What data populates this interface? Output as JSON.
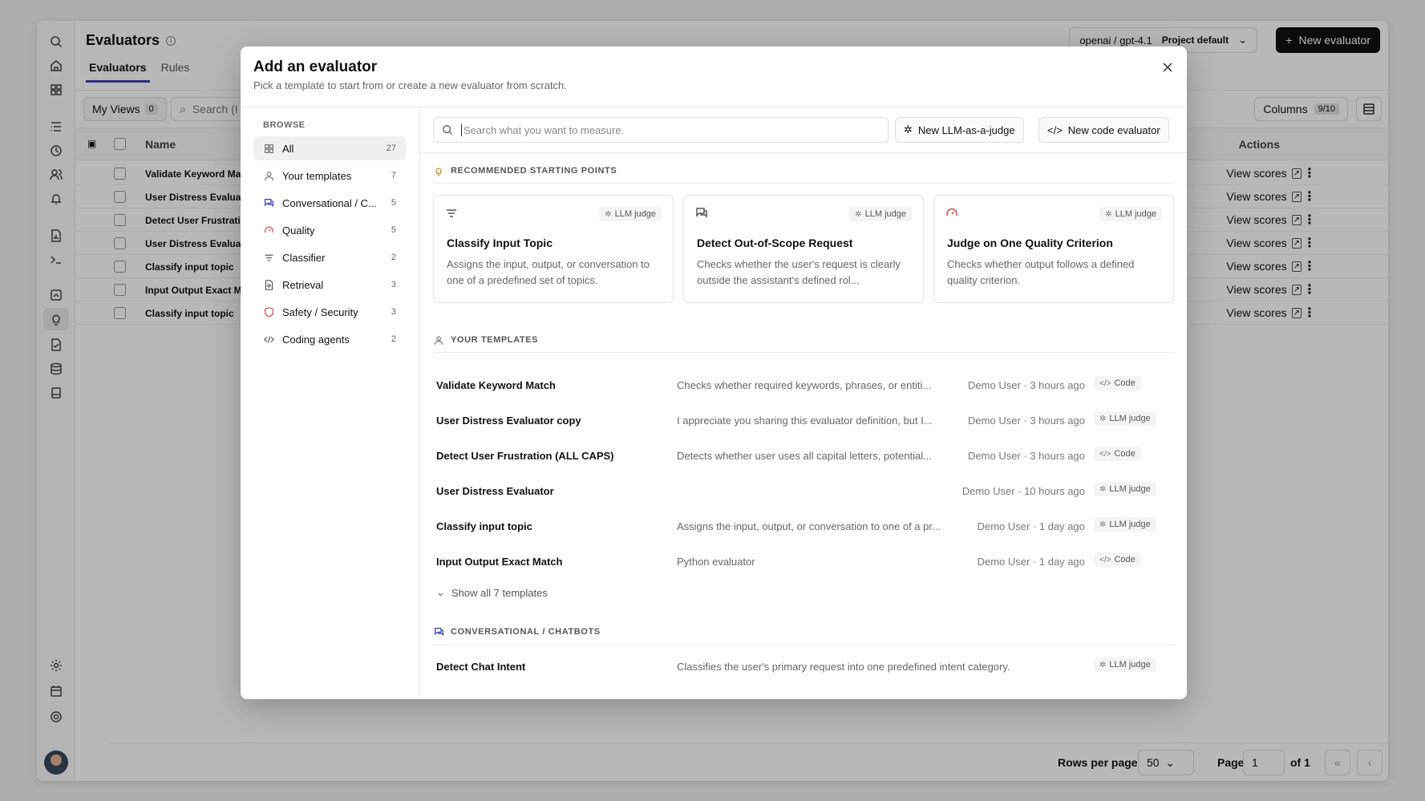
{
  "page": {
    "title": "Evaluators",
    "tabs": [
      {
        "label": "Evaluators"
      },
      {
        "label": "Rules"
      }
    ],
    "model_label": "openai / gpt-4.1",
    "model_badge": "Project default",
    "new_evaluator_label": "New evaluator",
    "my_views_label": "My Views",
    "my_views_count": "0",
    "search_placeholder": "Search (I",
    "columns_label": "Columns",
    "columns_count": "9/10",
    "col_name": "Name",
    "col_actions": "Actions",
    "view_scores_label": "View scores",
    "rows": [
      {
        "name": "Validate Keyword Mat"
      },
      {
        "name": "User Distress Evaluat"
      },
      {
        "name": "Detect User Frustrati"
      },
      {
        "name": "User Distress Evaluat"
      },
      {
        "name": "Classify input topic"
      },
      {
        "name": "Input Output Exact Ma"
      },
      {
        "name": "Classify input topic"
      }
    ],
    "rows_per_page_label": "Rows per page",
    "rows_per_page_value": "50",
    "page_label": "Page",
    "page_value": "1",
    "page_of": "of 1"
  },
  "modal": {
    "title": "Add an evaluator",
    "subtitle": "Pick a template to start from or create a new evaluator from scratch.",
    "browse_label": "BROWSE",
    "browse_items": [
      {
        "label": "All",
        "count": "27",
        "icon": "grid-icon"
      },
      {
        "label": "Your templates",
        "count": "7",
        "icon": "user-icon"
      },
      {
        "label": "Conversational / C...",
        "count": "5",
        "icon": "chat-icon"
      },
      {
        "label": "Quality",
        "count": "5",
        "icon": "gauge-icon"
      },
      {
        "label": "Classifier",
        "count": "2",
        "icon": "filter-icon"
      },
      {
        "label": "Retrieval",
        "count": "3",
        "icon": "document-search-icon"
      },
      {
        "label": "Safety / Security",
        "count": "3",
        "icon": "shield-icon"
      },
      {
        "label": "Coding agents",
        "count": "2",
        "icon": "code-icon"
      }
    ],
    "search_placeholder": "Search what you want to measure.",
    "new_llm_label": "New LLM-as-a-judge",
    "new_code_label": "New code evaluator",
    "recommended_label": "RECOMMENDED STARTING POINTS",
    "cards": [
      {
        "title": "Classify Input Topic",
        "desc": "Assigns the input, output, or conversation to one of a predefined set of topics.",
        "badge": "LLM judge"
      },
      {
        "title": "Detect Out-of-Scope Request",
        "desc": "Checks whether the user's request is clearly outside the assistant's defined rol...",
        "badge": "LLM judge"
      },
      {
        "title": "Judge on One Quality Criterion",
        "desc": "Checks whether output follows a defined quality criterion.",
        "badge": "LLM judge"
      }
    ],
    "your_templates_label": "YOUR TEMPLATES",
    "templates": [
      {
        "name": "Validate Keyword Match",
        "desc": "Checks whether required keywords, phrases, or entiti...",
        "meta": "Demo User · 3 hours ago",
        "badge": "Code"
      },
      {
        "name": "User Distress Evaluator copy",
        "desc": "I appreciate you sharing this evaluator definition, but I...",
        "meta": "Demo User · 3 hours ago",
        "badge": "LLM judge"
      },
      {
        "name": "Detect User Frustration (ALL CAPS)",
        "desc": "Detects whether user uses all capital letters, potential...",
        "meta": "Demo User · 3 hours ago",
        "badge": "Code"
      },
      {
        "name": "User Distress Evaluator",
        "desc": "",
        "meta": "Demo User · 10 hours ago",
        "badge": "LLM judge"
      },
      {
        "name": "Classify input topic",
        "desc": "Assigns the input, output, or conversation to one of a pr...",
        "meta": "Demo User · 1 day ago",
        "badge": "LLM judge"
      },
      {
        "name": "Input Output Exact Match",
        "desc": "Python evaluator",
        "meta": "Demo User · 1 day ago",
        "badge": "Code"
      }
    ],
    "show_all_label": "Show all 7 templates",
    "conversational_label": "CONVERSATIONAL / CHATBOTS",
    "conversational_items": [
      {
        "name": "Detect Chat Intent",
        "desc": "Classifies the user's primary request into one predefined intent category.",
        "badge": "LLM judge"
      }
    ]
  },
  "colors": {
    "accent": "#3b3fc4",
    "primary_button": "#111111",
    "quality_icon": "#d9534f",
    "recommended_icon": "#c8871b"
  }
}
